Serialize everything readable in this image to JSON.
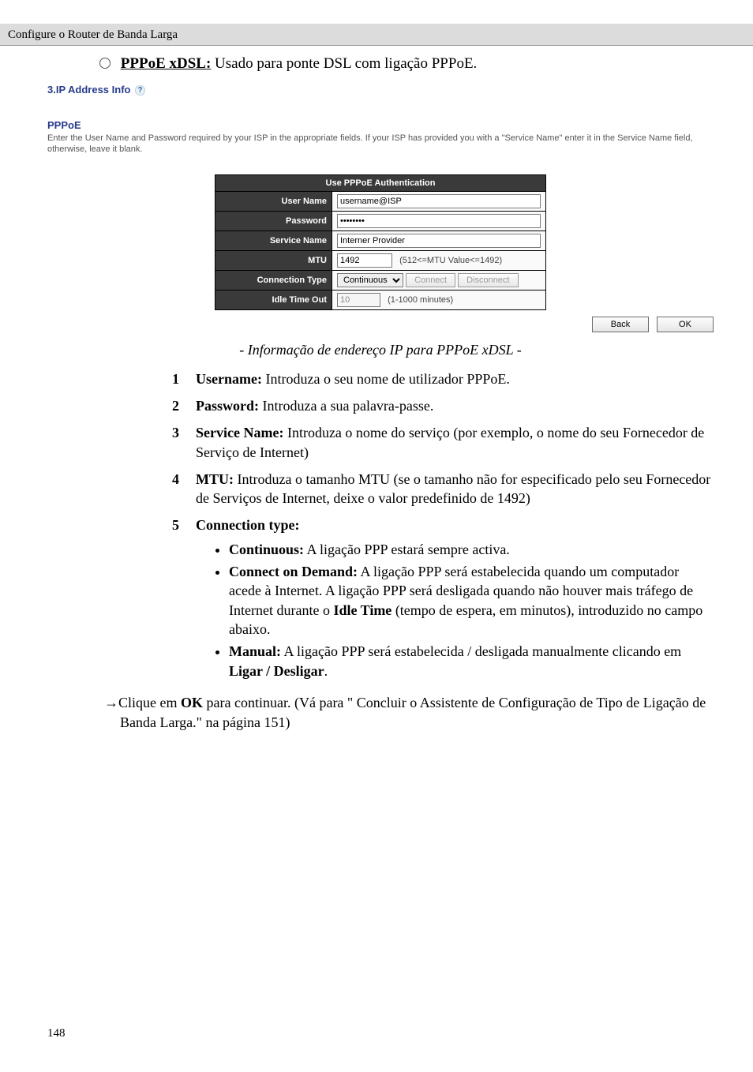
{
  "header": {
    "breadcrumb": "Configure o Router de Banda Larga"
  },
  "bullet": {
    "label": "PPPoE xDSL:",
    "desc": " Usado para ponte DSL com ligação PPPoE."
  },
  "section": {
    "title": "3.IP Address Info ",
    "subtitle": "PPPoE",
    "intro": "Enter the User Name and Password required by your ISP in the appropriate fields. If your ISP has provided you with a \"Service Name\" enter it in the Service Name field, otherwise, leave it blank."
  },
  "table": {
    "header": "Use PPPoE Authentication",
    "rows": {
      "username_label": "User Name",
      "username_value": "username@ISP",
      "password_label": "Password",
      "password_value": "********",
      "service_label": "Service Name",
      "service_value": "Interner Provider",
      "mtu_label": "MTU",
      "mtu_value": "1492",
      "mtu_hint": "(512<=MTU Value<=1492)",
      "conn_label": "Connection Type",
      "conn_value": "Continuous",
      "connect_btn": "Connect",
      "disconnect_btn": "Disconnect",
      "idle_label": "Idle Time Out",
      "idle_value": "10",
      "idle_hint": "(1-1000 minutes)"
    }
  },
  "nav": {
    "back": "Back",
    "ok": "OK"
  },
  "caption": "- Informação de endereço IP para PPPoE xDSL -",
  "steps": {
    "s1_b": "Username:",
    "s1_t": " Introduza o seu nome de utilizador PPPoE.",
    "s2_b": "Password:",
    "s2_t": " Introduza a sua palavra-passe.",
    "s3_b": "Service Name:",
    "s3_t": " Introduza o nome do serviço (por exemplo, o nome do seu Fornecedor de Serviço de Internet)",
    "s4_b": "MTU:",
    "s4_t": " Introduza o tamanho MTU (se o tamanho não for especificado pelo seu Fornecedor de Serviços de Internet, deixe o valor predefinido de 1492)",
    "s5_b": "Connection type:",
    "sub": {
      "c_b": "Continuous:",
      "c_t": " A ligação PPP estará sempre activa.",
      "d_b": "Connect on Demand:",
      "d_t1": " A ligação PPP será estabelecida quando um computador acede à Internet. A ligação PPP será desligada quando não houver mais tráfego de Internet durante o ",
      "d_idle": "Idle Time",
      "d_t2": " (tempo de espera, em minutos), introduzido no campo abixo.",
      "d_t2_fix": " (tempo de espera, em minutos), introduzido no campo abaixo.",
      "m_b": "Manual:",
      "m_t1": " A ligação PPP será estabelecida / desligada manualmente clicando em ",
      "m_bold": "Ligar / Desligar",
      "m_t2": "."
    }
  },
  "closing": {
    "pre": "Clique em ",
    "ok": "OK",
    "mid": " para continuar. (Vá para \" Concluir o Assistente de Configuração de Tipo de Ligação de Banda Larga.\" na página 151)"
  },
  "page_number": "148"
}
